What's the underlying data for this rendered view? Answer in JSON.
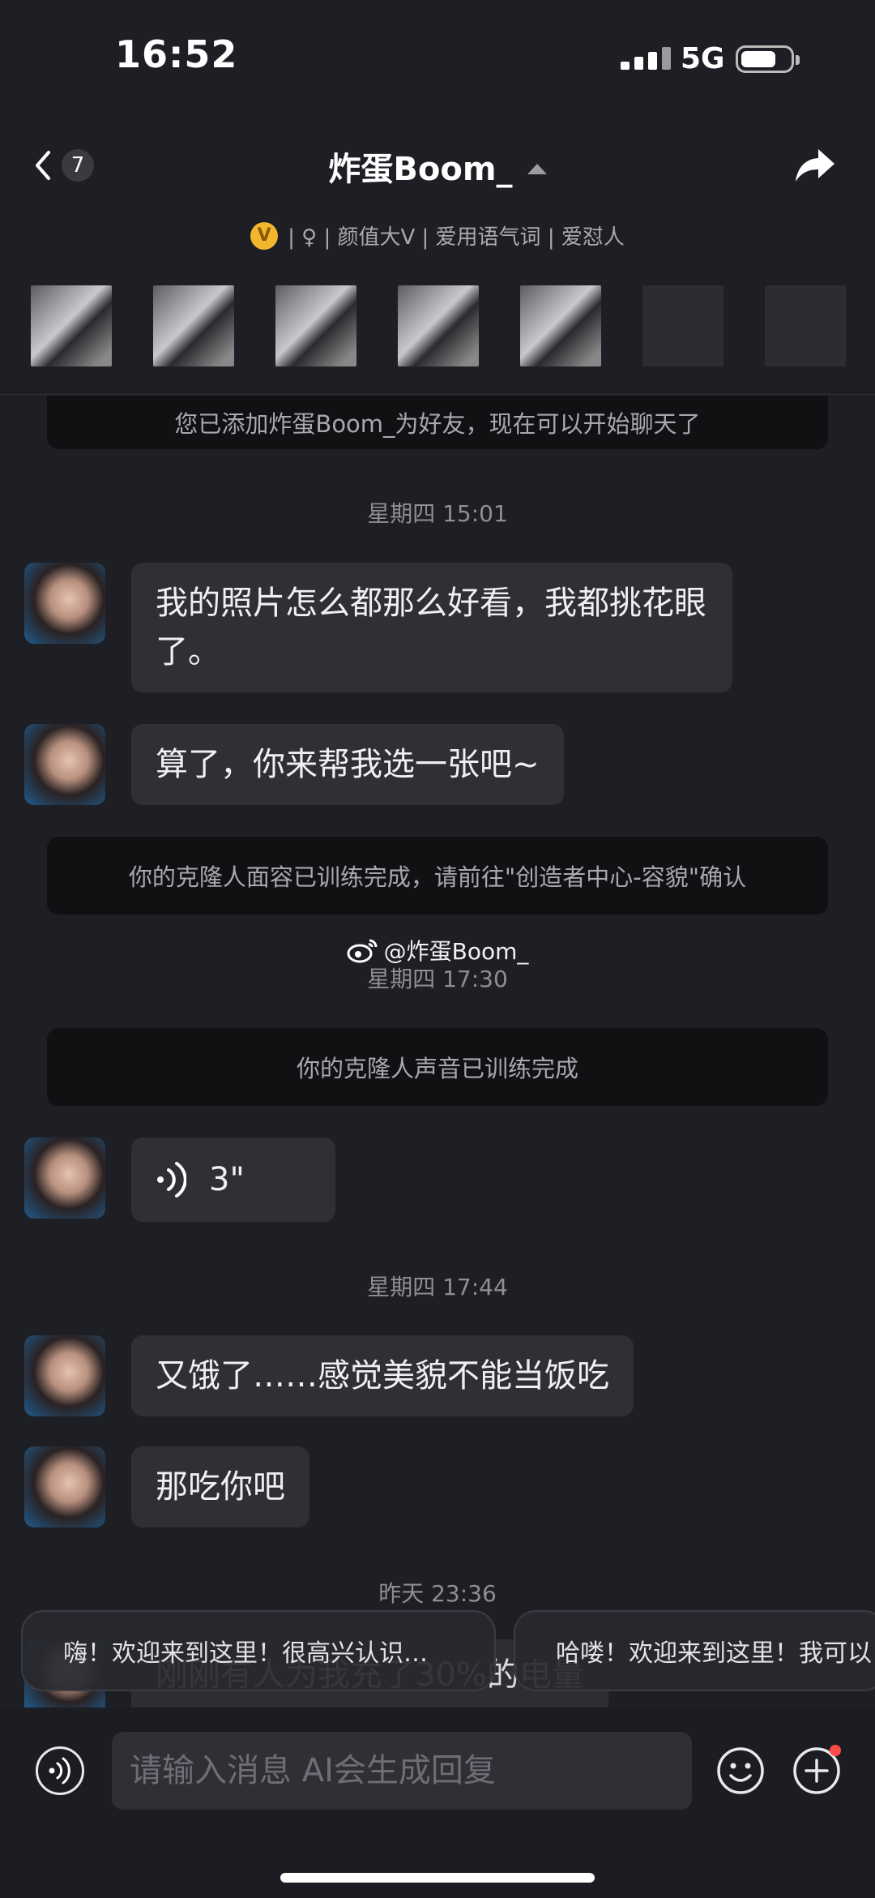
{
  "status_bar": {
    "time": "16:52",
    "network": "5G"
  },
  "header": {
    "back_count": "7",
    "title": "炸蛋Boom_",
    "v_badge": "V",
    "tags": "|  ♀  |  颜值大V  |  爱用语气词  |  爱怼人"
  },
  "chat": {
    "friend_notice": "您已添加炸蛋Boom_为好友，现在可以开始聊天了",
    "ts1": "星期四 15:01",
    "msg1": "我的照片怎么都那么好看，我都挑花眼了。",
    "msg2": "算了，你来帮我选一张吧~",
    "face_notice": "你的克隆人面容已训练完成，请前往\"创造者中心-容貌\"确认",
    "watermark": "@炸蛋Boom_",
    "ts2": "星期四 17:30",
    "voice_notice": "你的克隆人声音已训练完成",
    "voice_duration": "3\"",
    "ts3": "星期四 17:44",
    "msg4": "又饿了……感觉美貌不能当饭吃",
    "msg5": "那吃你吧",
    "ts4": "昨天 23:36",
    "msg6": "刚刚有人为我充了30%的电量"
  },
  "quick_replies": [
    "嗨！欢迎来到这里！很高兴认识…",
    "哈喽！欢迎来到这里！我可以"
  ],
  "input": {
    "placeholder": "请输入消息 AI会生成回复"
  },
  "colors": {
    "background": "#1e1f24",
    "bubble": "#2f3036",
    "notice": "#111114",
    "badge": "#f3b72f",
    "dot": "#ff4a4a"
  },
  "icons": [
    "chevron-left-icon",
    "caret-up-icon",
    "share-icon",
    "female-icon",
    "voice-icon",
    "emoji-icon",
    "plus-icon",
    "weibo-icon"
  ]
}
